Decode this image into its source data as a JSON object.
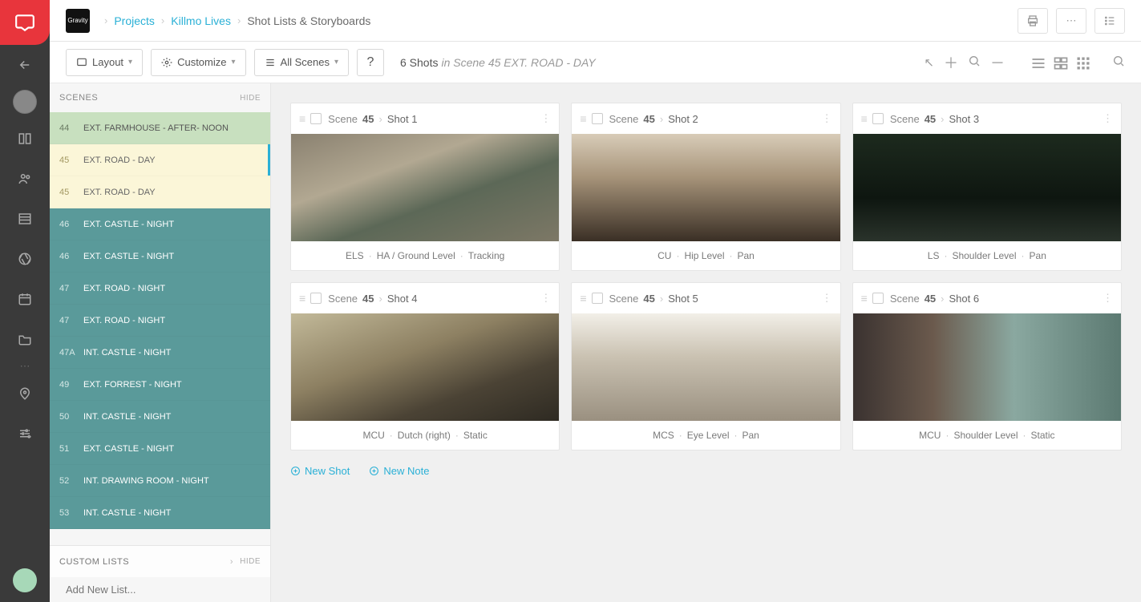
{
  "breadcrumbs": {
    "projects": "Projects",
    "project": "Killmo Lives",
    "page": "Shot Lists & Storyboards",
    "brandTile": "Gravity"
  },
  "toolbar": {
    "layout": "Layout",
    "customize": "Customize",
    "allScenes": "All Scenes",
    "help": "?",
    "shotCountLabel": "6 Shots",
    "contextLabel": "in Scene 45 EXT. ROAD - DAY"
  },
  "scenesHeader": {
    "title": "SCENES",
    "hide": "HIDE"
  },
  "scenes": [
    {
      "num": "44",
      "name": "EXT. FARMHOUSE - AFTER- NOON",
      "cls": "green"
    },
    {
      "num": "45",
      "name": "EXT. ROAD - DAY",
      "cls": "yellow",
      "active": true
    },
    {
      "num": "45",
      "name": "EXT. ROAD - DAY",
      "cls": "yellow"
    },
    {
      "num": "46",
      "name": "EXT. CASTLE - NIGHT",
      "cls": "teal"
    },
    {
      "num": "46",
      "name": "EXT. CASTLE - NIGHT",
      "cls": "teal"
    },
    {
      "num": "47",
      "name": "EXT. ROAD - NIGHT",
      "cls": "teal"
    },
    {
      "num": "47",
      "name": "EXT. ROAD - NIGHT",
      "cls": "teal"
    },
    {
      "num": "47A",
      "name": "INT. CASTLE - NIGHT",
      "cls": "teal"
    },
    {
      "num": "49",
      "name": "EXT. FORREST - NIGHT",
      "cls": "teal"
    },
    {
      "num": "50",
      "name": "INT. CASTLE - NIGHT",
      "cls": "teal"
    },
    {
      "num": "51",
      "name": "EXT. CASTLE - NIGHT",
      "cls": "teal"
    },
    {
      "num": "52",
      "name": "INT. DRAWING ROOM - NIGHT",
      "cls": "teal"
    },
    {
      "num": "53",
      "name": "INT. CASTLE - NIGHT",
      "cls": "teal"
    }
  ],
  "customLists": {
    "title": "CUSTOM LISTS",
    "hide": "HIDE",
    "placeholder": "Add New List..."
  },
  "cards": [
    {
      "sceneLabel": "Scene",
      "sceneNum": "45",
      "shot": "Shot 1",
      "meta": [
        "ELS",
        "HA / Ground Level",
        "Tracking"
      ],
      "img": "img1"
    },
    {
      "sceneLabel": "Scene",
      "sceneNum": "45",
      "shot": "Shot 2",
      "meta": [
        "CU",
        "Hip Level",
        "Pan"
      ],
      "img": "img2"
    },
    {
      "sceneLabel": "Scene",
      "sceneNum": "45",
      "shot": "Shot 3",
      "meta": [
        "LS",
        "Shoulder Level",
        "Pan"
      ],
      "img": "img3"
    },
    {
      "sceneLabel": "Scene",
      "sceneNum": "45",
      "shot": "Shot 4",
      "meta": [
        "MCU",
        "Dutch (right)",
        "Static"
      ],
      "img": "img4"
    },
    {
      "sceneLabel": "Scene",
      "sceneNum": "45",
      "shot": "Shot 5",
      "meta": [
        "MCS",
        "Eye Level",
        "Pan"
      ],
      "img": "img5"
    },
    {
      "sceneLabel": "Scene",
      "sceneNum": "45",
      "shot": "Shot 6",
      "meta": [
        "MCU",
        "Shoulder Level",
        "Static"
      ],
      "img": "img6"
    }
  ],
  "actions": {
    "newShot": "New Shot",
    "newNote": "New Note"
  }
}
